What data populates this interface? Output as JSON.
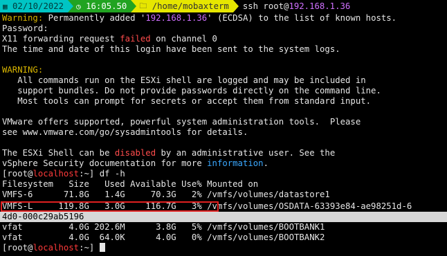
{
  "prompt": {
    "date": "02/10/2022",
    "time": "16:05.50",
    "path": "/home/mobaxterm",
    "command_prefix": "ssh root@",
    "command_host": "192.168.1.36"
  },
  "warn_line": {
    "label": "Warning:",
    "text1": " Permanently added '",
    "host": "192.168.1.36",
    "text2": "' (ECDSA) to the list of known hosts."
  },
  "password_line": "Password:",
  "x11_line": {
    "text1": "X11 forwarding request ",
    "failed": "failed",
    "text2": " on channel 0"
  },
  "login_notice": "The time and date of this login have been sent to the system logs.",
  "warning_header": "WARNING:",
  "warning_lines": [
    "   All commands run on the ESXi shell are logged and may be included in",
    "   support bundles. Do not provide passwords directly on the command line.",
    "   Most tools can prompt for secrets or accept them from standard input."
  ],
  "vmware_lines": [
    "VMware offers supported, powerful system administration tools.  Please",
    "see www.vmware.com/go/sysadmintools for details."
  ],
  "disable_line": {
    "text1": "The ESXi Shell can be ",
    "disabled": "disabled",
    "text2": " by an administrative user. See the"
  },
  "doc_line": {
    "text1": "vSphere Security documentation for more ",
    "information": "information",
    "text2": "."
  },
  "shell": {
    "open": "[",
    "user": "root",
    "at": "@",
    "host": "localhost",
    "close": ":~] ",
    "command": "df -h"
  },
  "df": {
    "header": "Filesystem   Size   Used Available Use% Mounted on",
    "rows": [
      "VMFS-6      71.8G   1.4G     70.3G   2% /vmfs/volumes/datastore1",
      "VMFS-L     119.8G   3.0G    116.7G   3% /vmfs/volumes/OSDATA-63393e84-ae98251d-6",
      "4d0-000c29ab5196",
      "vfat         4.0G 202.6M      3.8G   5% /vmfs/volumes/BOOTBANK1",
      "vfat         4.0G  64.0K      4.0G   0% /vmfs/volumes/BOOTBANK2"
    ]
  },
  "colors": {
    "prompt_seg1": "#00c4c4",
    "prompt_seg2": "#21a321",
    "prompt_seg3": "#e6e600",
    "highlight_box": "#e02020",
    "selection_bg": "#d7d7d7"
  }
}
